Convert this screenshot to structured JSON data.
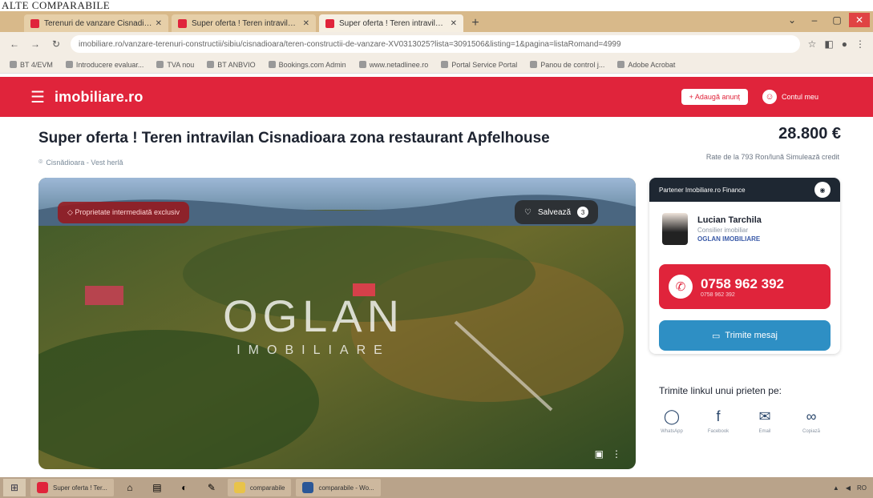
{
  "document_heading": "ALTE COMPARABILE",
  "browser": {
    "tabs": [
      {
        "title": "Terenuri de vanzare Cisnadioara",
        "active": false
      },
      {
        "title": "Super oferta ! Teren intravilan C",
        "active": false
      },
      {
        "title": "Super oferta ! Teren intravilan C",
        "active": true
      }
    ],
    "new_tab": "+",
    "url_host": "imobiliare.ro",
    "url_path": "/vanzare-terenuri-constructii/sibiu/cisnadioara/teren-constructii-de-vanzare-XV0313025?lista=3091506&listing=1&pagina=listaRomand=4999"
  },
  "bookmarks": [
    "BT 4/EVM",
    "Introducere evaluar...",
    "TVA nou",
    "BT ANBVIO",
    "Bookings.com Admin",
    "www.netadlinee.ro",
    "Portal Service Portal",
    "Panou de control j...",
    "Adobe Acrobat"
  ],
  "site": {
    "logo": "imobiliare.ro",
    "add_listing": "+ Adaugă anunț",
    "account": "Contul meu"
  },
  "listing": {
    "title": "Super oferta ! Teren intravilan Cisnadioara zona restaurant Apfelhouse",
    "price": "28.800 €",
    "location": "Cisnădioara - Vest herlă",
    "rate_text": "Rate de la 793 Ron/lună  Simulează credit",
    "badge": "Proprietate intermediată exclusiv",
    "save_label": "Salvează",
    "save_count": "3",
    "watermark_main": "OGLAN",
    "watermark_sub": "IMOBILIARE"
  },
  "agent": {
    "partner_label": "Partener Imobiliare.ro Finance",
    "name": "Lucian Tarchila",
    "role": "Consilier imobiliar",
    "agency": "OGLAN IMOBILIARE",
    "phone": "0758 962 392",
    "phone_sub": "0758 962 392",
    "message_label": "Trimite mesaj"
  },
  "share": {
    "title": "Trimite linkul unui prieten pe:",
    "items": [
      {
        "label": "WhatsApp",
        "icon": "whatsapp-icon"
      },
      {
        "label": "Facebook",
        "icon": "facebook-icon"
      },
      {
        "label": "Email",
        "icon": "email-icon"
      },
      {
        "label": "Copiază",
        "icon": "link-icon"
      }
    ]
  },
  "taskbar": {
    "apps": [
      "Super oferta ! Ter...",
      "comparabile",
      "comparabile - Wo..."
    ],
    "tray": "RO"
  },
  "colors": {
    "brand": "#e0243b",
    "accent_blue": "#2e8fc4",
    "dark": "#1e2732"
  }
}
